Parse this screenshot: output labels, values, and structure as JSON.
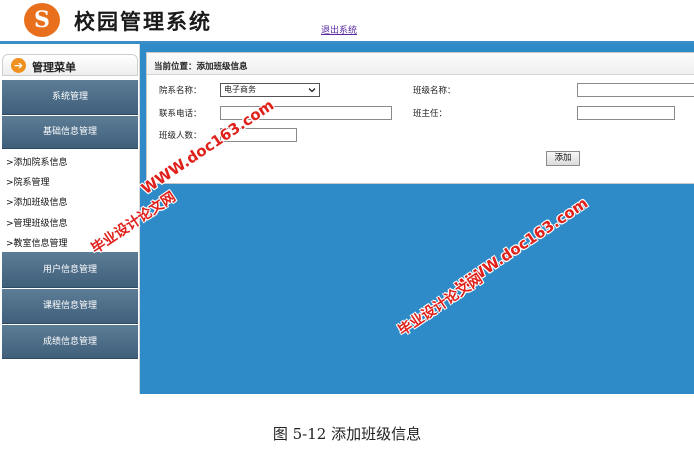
{
  "header": {
    "logo_letter": "S",
    "title": "校园管理系统",
    "logout_label": "退出系统"
  },
  "sidebar": {
    "menu_title": "管理菜单",
    "groups": [
      {
        "label": "系统管理"
      },
      {
        "label": "基础信息管理"
      },
      {
        "label": "用户信息管理"
      },
      {
        "label": "课程信息管理"
      },
      {
        "label": "成绩信息管理"
      }
    ],
    "sub_items": [
      ">添加院系信息",
      ">院系管理",
      ">添加班级信息",
      ">管理班级信息",
      ">教室信息管理"
    ]
  },
  "main": {
    "breadcrumb": "当前位置：添加班级信息",
    "form": {
      "dept_label": "院系名称：",
      "dept_value": "电子商务",
      "class_name_label": "班级名称：",
      "class_name_value": "",
      "phone_label": "联系电话：",
      "phone_value": "",
      "teacher_label": "班主任：",
      "teacher_value": "",
      "count_label": "班级人数：",
      "count_value": "",
      "submit_label": "添加"
    }
  },
  "watermarks": [
    "WWW.doc163.com",
    "毕业设计论文网",
    "WWW.doc163.com",
    "毕业设计论文网"
  ],
  "caption": "图 5-12 添加班级信息",
  "colors": {
    "accent_blue": "#2e8bc7",
    "menu_group": "#4a6a85",
    "logo_orange": "#e8701d",
    "watermark_red": "#e0201a"
  }
}
